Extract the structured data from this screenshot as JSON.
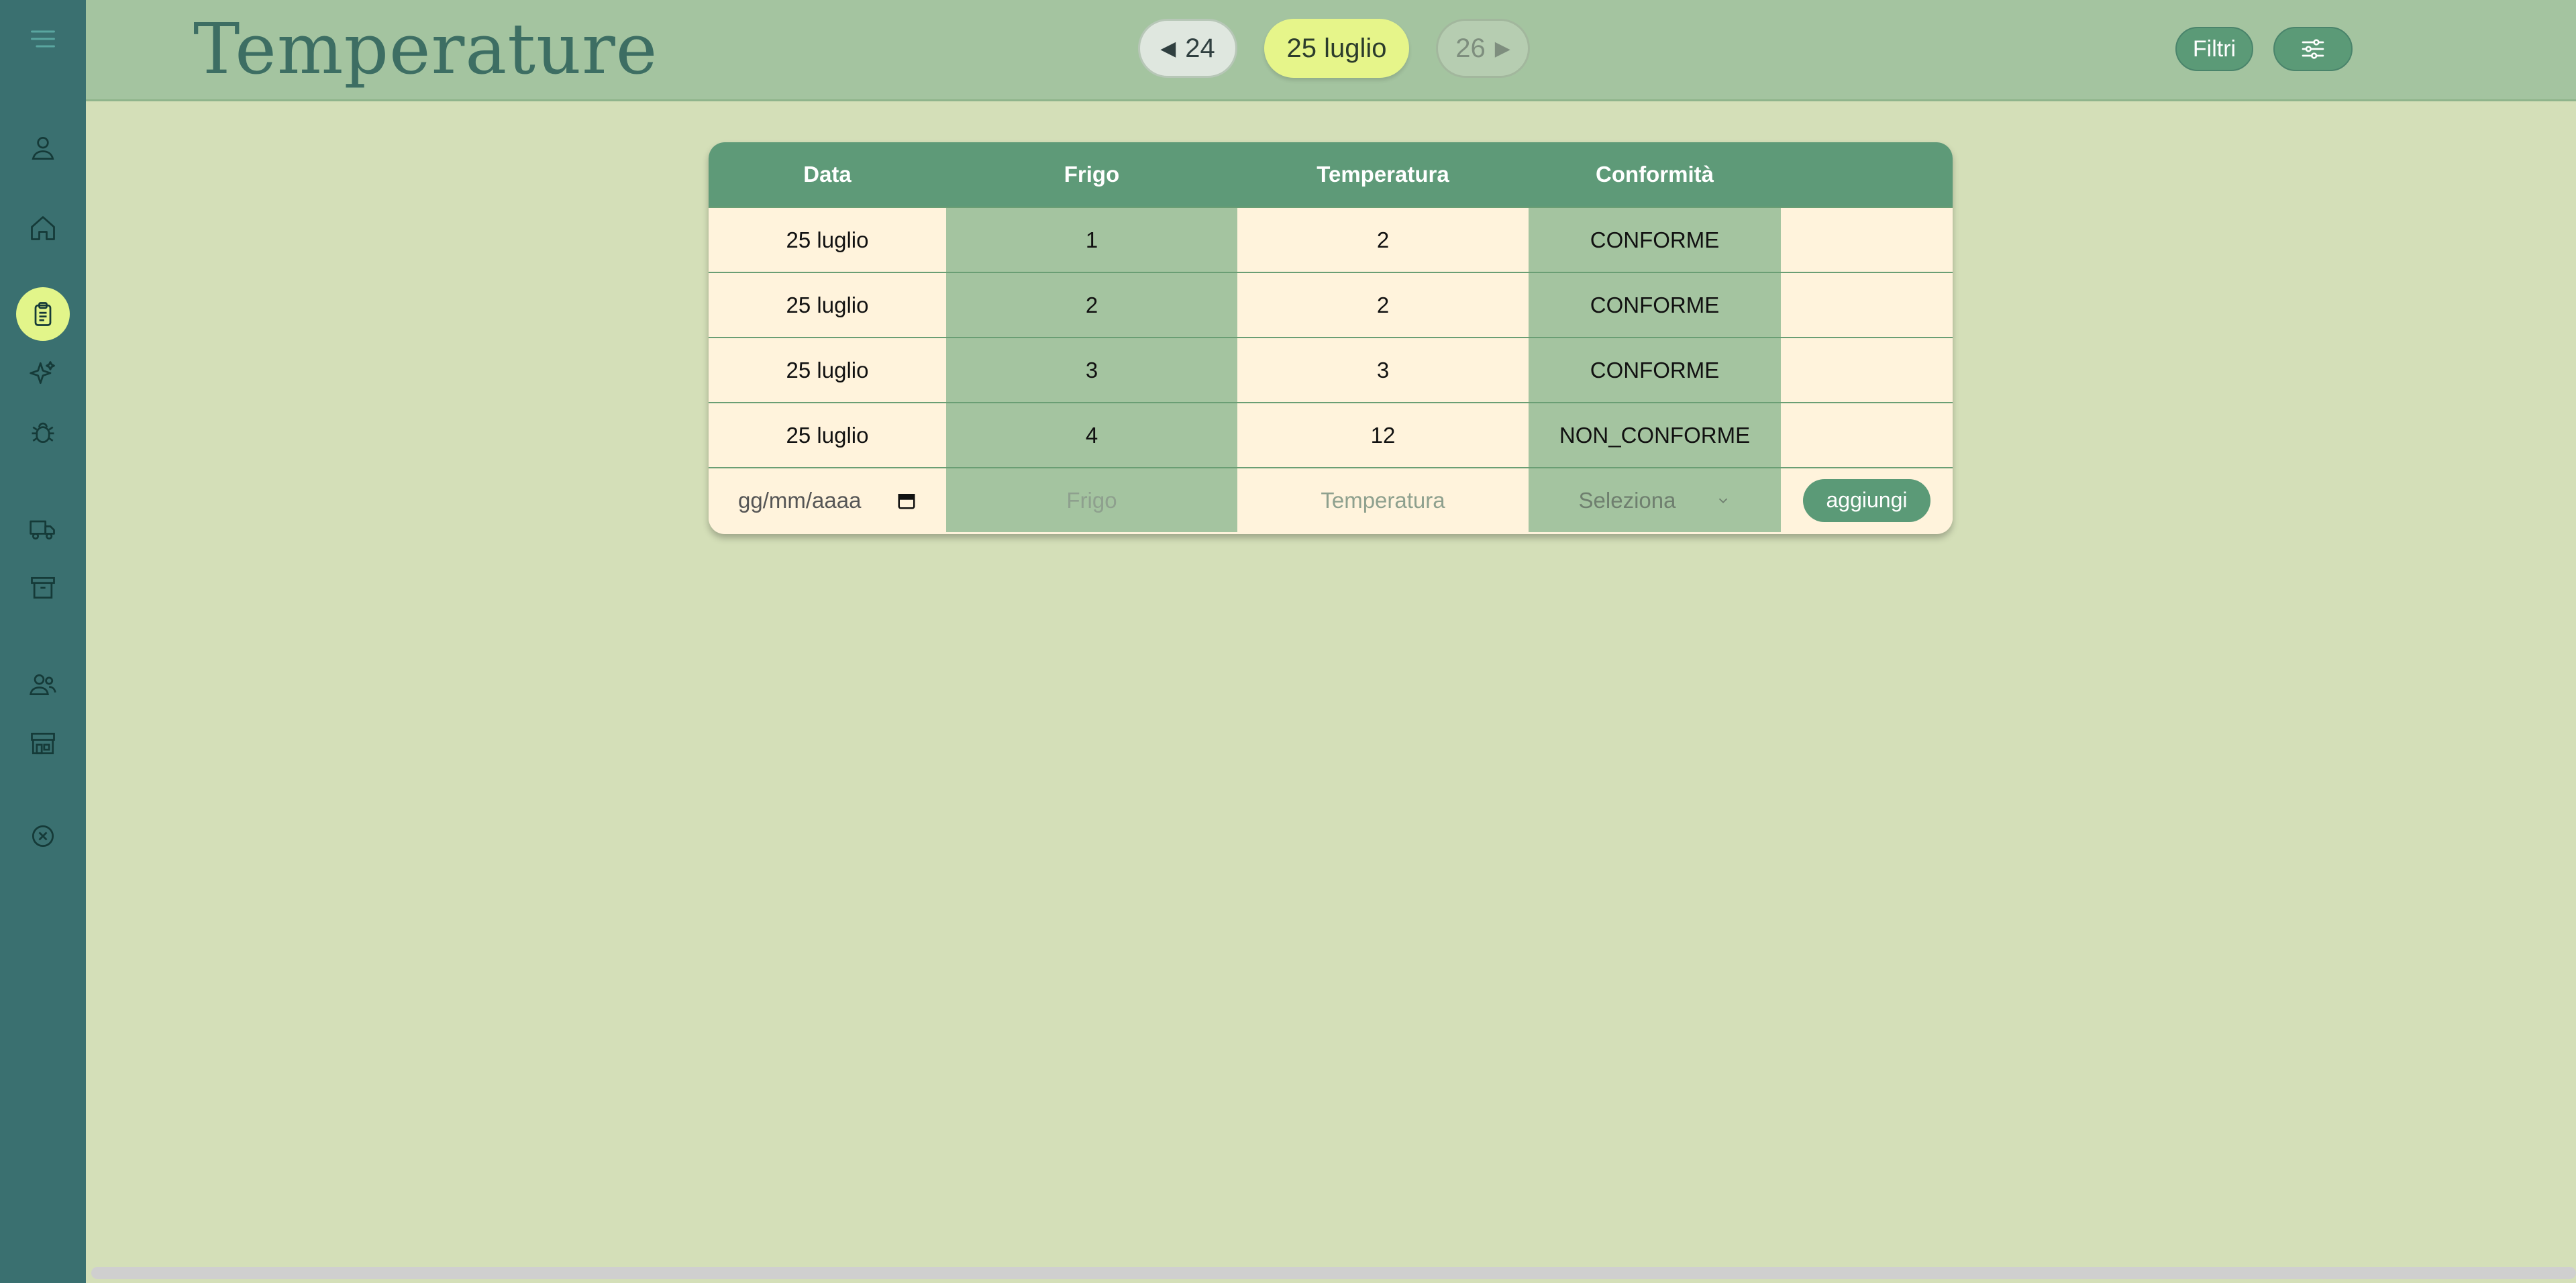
{
  "header": {
    "title": "Temperature",
    "prev_day": "24",
    "current_day": "25 luglio",
    "next_day": "26",
    "filters_label": "Filtri"
  },
  "sidebar": {
    "items": [
      {
        "icon": "menu-icon"
      },
      {
        "icon": "user-icon"
      },
      {
        "icon": "home-icon"
      },
      {
        "icon": "clipboard-icon",
        "active": true
      },
      {
        "icon": "sparkles-icon"
      },
      {
        "icon": "bug-icon"
      },
      {
        "icon": "truck-icon"
      },
      {
        "icon": "archive-icon"
      },
      {
        "icon": "users-icon"
      },
      {
        "icon": "store-icon"
      },
      {
        "icon": "close-circle-icon"
      }
    ]
  },
  "table": {
    "headers": [
      "Data",
      "Frigo",
      "Temperatura",
      "Conformità",
      ""
    ],
    "rows": [
      {
        "data": "25 luglio",
        "frigo": "1",
        "temperatura": "2",
        "conformita": "CONFORME"
      },
      {
        "data": "25 luglio",
        "frigo": "2",
        "temperatura": "2",
        "conformita": "CONFORME"
      },
      {
        "data": "25 luglio",
        "frigo": "3",
        "temperatura": "3",
        "conformita": "CONFORME"
      },
      {
        "data": "25 luglio",
        "frigo": "4",
        "temperatura": "12",
        "conformita": "NON_CONFORME"
      }
    ],
    "new_row": {
      "date_placeholder": "gg/mm/aaaa",
      "frigo_placeholder": "Frigo",
      "temperatura_placeholder": "Temperatura",
      "select_placeholder": "Seleziona",
      "add_label": "aggiungi"
    }
  },
  "colors": {
    "sidebar": "#3a7070",
    "header": "#a4c4a0",
    "background": "#d4dfb8",
    "accent": "#5b9a77",
    "active": "#e2f58a"
  }
}
